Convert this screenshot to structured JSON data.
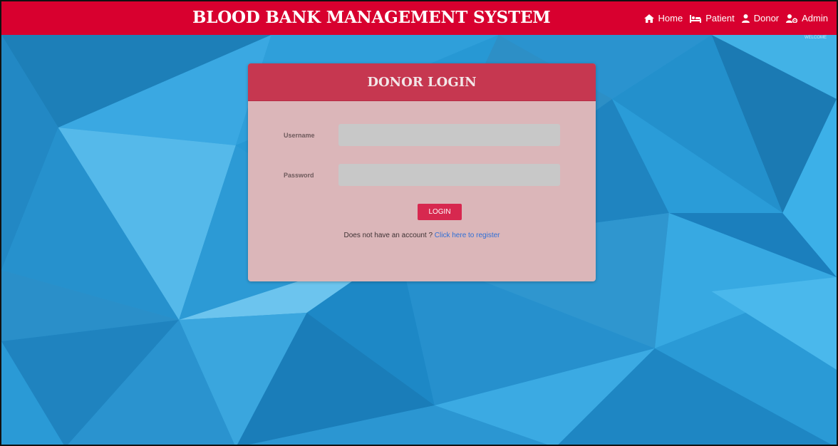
{
  "navbar": {
    "brand": "BLOOD BANK MANAGEMENT SYSTEM",
    "items": [
      {
        "label": "Home",
        "icon": "home-icon"
      },
      {
        "label": "Patient",
        "icon": "bed-icon"
      },
      {
        "label": "Donor",
        "icon": "user-icon"
      },
      {
        "label": "Admin",
        "icon": "user-cog-icon"
      }
    ],
    "corner_text": "WELCOME"
  },
  "login": {
    "title": "DONOR LOGIN",
    "username_label": "Username",
    "password_label": "Password",
    "username_value": "",
    "password_value": "",
    "button_label": "LOGIN",
    "register_prompt": "Does not have an account ?",
    "register_link": "Click here to register"
  },
  "colors": {
    "navbar": "#d8002f",
    "card_header": "#c63750",
    "card_body": "#dbb6b9",
    "button": "#d7284f",
    "link": "#2f6fd6",
    "background": "#2c9fdb"
  }
}
